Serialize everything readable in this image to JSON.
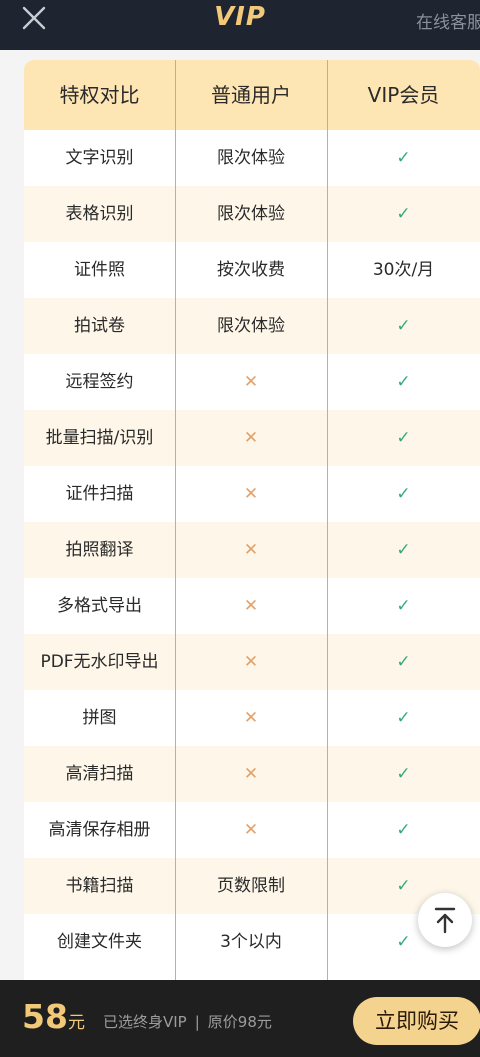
{
  "header": {
    "title": "VIP",
    "service_label": "在线客服"
  },
  "table": {
    "headers": [
      "特权对比",
      "普通用户",
      "VIP会员"
    ],
    "rows": [
      {
        "feature": "文字识别",
        "normal": "限次体验",
        "vip": "✓"
      },
      {
        "feature": "表格识别",
        "normal": "限次体验",
        "vip": "✓"
      },
      {
        "feature": "证件照",
        "normal": "按次收费",
        "vip": "30次/月"
      },
      {
        "feature": "拍试卷",
        "normal": "限次体验",
        "vip": "✓"
      },
      {
        "feature": "远程签约",
        "normal": "✕",
        "vip": "✓"
      },
      {
        "feature": "批量扫描/识别",
        "normal": "✕",
        "vip": "✓"
      },
      {
        "feature": "证件扫描",
        "normal": "✕",
        "vip": "✓"
      },
      {
        "feature": "拍照翻译",
        "normal": "✕",
        "vip": "✓"
      },
      {
        "feature": "多格式导出",
        "normal": "✕",
        "vip": "✓"
      },
      {
        "feature": "PDF无水印导出",
        "normal": "✕",
        "vip": "✓"
      },
      {
        "feature": "拼图",
        "normal": "✕",
        "vip": "✓"
      },
      {
        "feature": "高清扫描",
        "normal": "✕",
        "vip": "✓"
      },
      {
        "feature": "高清保存相册",
        "normal": "✕",
        "vip": "✓"
      },
      {
        "feature": "书籍扫描",
        "normal": "页数限制",
        "vip": "✓"
      },
      {
        "feature": "创建文件夹",
        "normal": "3个以内",
        "vip": "✓"
      }
    ]
  },
  "footer": {
    "price": "58",
    "price_unit": "元",
    "selected_plan": "已选终身VIP",
    "separator": "|",
    "original_price": "原价98元",
    "buy_label": "立即购买"
  },
  "colors": {
    "gold": "#f2c879",
    "check": "#3aa97c",
    "cross": "#e0a26a",
    "header_bg": "#fde6b3",
    "stripe": "#fdf6e9",
    "button": "#f4d38f"
  }
}
